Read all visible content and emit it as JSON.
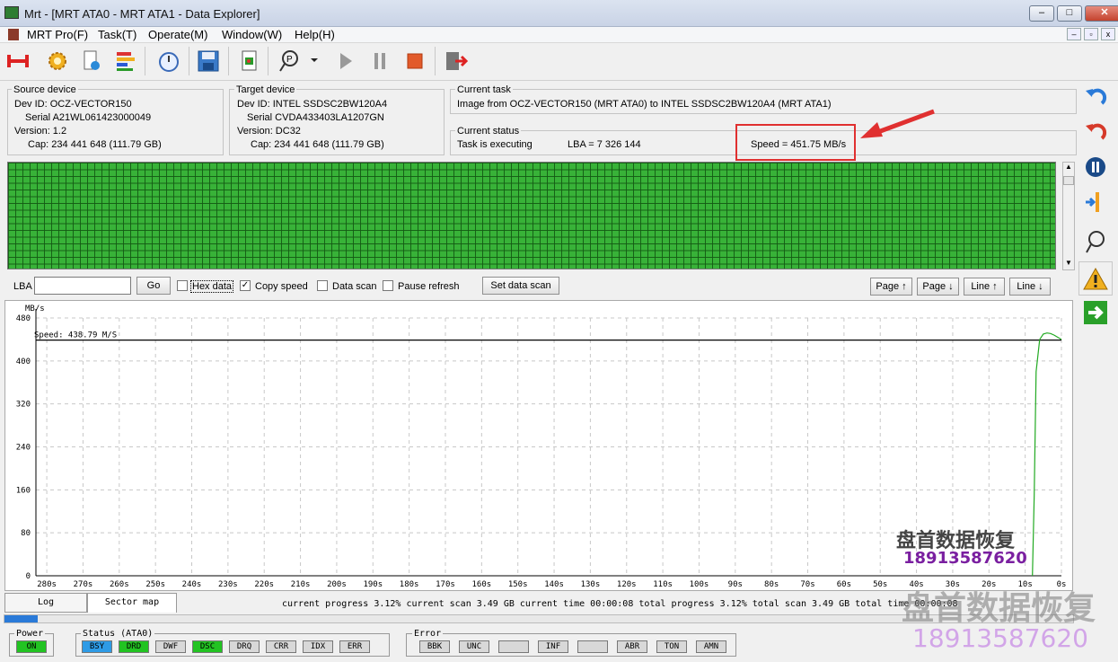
{
  "window": {
    "title": "Mrt - [MRT ATA0 - MRT ATA1 - Data Explorer]",
    "min_label": "–",
    "max_label": "□",
    "close_label": "✕"
  },
  "menu": [
    "MRT Pro(F)",
    "Task(T)",
    "Operate(M)",
    "Window(W)",
    "Help(H)"
  ],
  "mdi": {
    "min": "–",
    "restore": "▫",
    "close": "x"
  },
  "source": {
    "group": "Source device",
    "dev_id": "Dev ID: OCZ-VECTOR150",
    "serial": "Serial  A21WL061423000049",
    "version": "Version:  1.2",
    "cap": "Cap:  234 441 648 (111.79 GB)"
  },
  "target": {
    "group": "Target device",
    "dev_id": "Dev ID:  INTEL SSDSC2BW120A4",
    "serial": "Serial  CVDA433403LA1207GN",
    "version": "Version:  DC32",
    "cap": "Cap:  234 441 648 (111.79 GB)"
  },
  "task": {
    "group": "Current task",
    "text": "Image from OCZ-VECTOR150 (MRT ATA0) to INTEL SSDSC2BW120A4 (MRT ATA1)"
  },
  "status": {
    "group": "Current status",
    "state": "Task is executing",
    "lba": "LBA = 7 326 144",
    "speed": "Speed = 451.75 MB/s"
  },
  "controls": {
    "lba_label": "LBA",
    "lba_value": "",
    "go": "Go",
    "hex_data": "Hex data",
    "copy_speed": "Copy speed",
    "data_scan": "Data scan",
    "pause_refresh": "Pause refresh",
    "set_data_scan": "Set data scan",
    "page_up": "Page ↑",
    "page_down": "Page ↓",
    "line_up": "Line ↑",
    "line_down": "Line ↓"
  },
  "chart_data": {
    "type": "line",
    "ylabel": "MB/s",
    "annotation": "Speed: 438.79 M/S",
    "speed_line": 438.79,
    "ylim": [
      0,
      480
    ],
    "yticks": [
      0,
      80,
      160,
      240,
      320,
      400,
      480
    ],
    "xticks": [
      "280s",
      "270s",
      "260s",
      "250s",
      "240s",
      "230s",
      "220s",
      "210s",
      "200s",
      "190s",
      "180s",
      "170s",
      "160s",
      "150s",
      "140s",
      "130s",
      "120s",
      "110s",
      "100s",
      "90s",
      "80s",
      "70s",
      "60s",
      "50s",
      "40s",
      "30s",
      "20s",
      "10s",
      "0s"
    ],
    "xlim_seconds": [
      283,
      0
    ],
    "series": [
      {
        "x": [
          8,
          7.5,
          7,
          6,
          5,
          4,
          3,
          2,
          0
        ],
        "y": [
          0,
          150,
          380,
          440,
          450,
          452,
          451,
          448,
          440
        ]
      }
    ],
    "line_color": "#22aa22",
    "grid": true
  },
  "tabs": {
    "log": "Log",
    "sector_map": "Sector map"
  },
  "progress_text": "current progress 3.12% current scan  3.49 GB  current time  00:00:08   total progress 3.12% total scan 3.49 GB total time 00:00:08",
  "progress_fraction": 0.0312,
  "power": {
    "group": "Power",
    "on": "ON"
  },
  "status_ata": {
    "group": "Status (ATA0)",
    "flags": [
      "BSY",
      "DRD",
      "DWF",
      "DSC",
      "DRQ",
      "CRR",
      "IDX",
      "ERR"
    ],
    "active": [
      "BSY",
      "DRD",
      "DSC"
    ]
  },
  "error": {
    "group": "Error",
    "flags": [
      "BBK",
      "UNC",
      "",
      "INF",
      "",
      "ABR",
      "TON",
      "AMN"
    ]
  },
  "watermark": {
    "company": "盘首数据恢复",
    "phone": "18913587620"
  },
  "colors": {
    "green": "#22c322",
    "blue_active": "#2e9be6",
    "highlight": "#e03030"
  }
}
